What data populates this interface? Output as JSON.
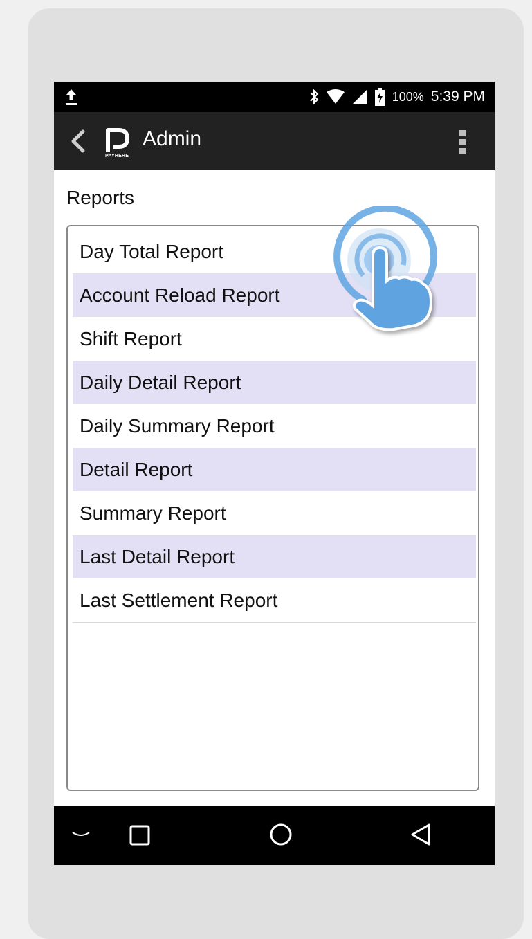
{
  "status_bar": {
    "icons": [
      "upload-icon",
      "bluetooth-icon",
      "wifi-icon",
      "cell-signal-icon",
      "battery-charging-icon"
    ],
    "battery": "100%",
    "time": "5:39 PM"
  },
  "app_bar": {
    "logo_text": "PAYHERE",
    "title": "Admin",
    "icons": [
      "back-chevron-icon",
      "payhere-logo",
      "overflow-menu-icon"
    ]
  },
  "reports": {
    "title": "Reports",
    "items": [
      {
        "label": "Day Total Report"
      },
      {
        "label": "Account Reload Report"
      },
      {
        "label": "Shift Report"
      },
      {
        "label": "Daily Detail Report"
      },
      {
        "label": "Daily Summary Report"
      },
      {
        "label": "Detail Report"
      },
      {
        "label": "Summary Report"
      },
      {
        "label": "Last Detail Report"
      },
      {
        "label": "Last Settlement Report"
      }
    ]
  },
  "nav_bar": {
    "icons": [
      "hide-keyboard-icon",
      "recent-apps-icon",
      "home-icon",
      "back-icon"
    ]
  },
  "colors": {
    "status_bar": "#000000",
    "app_bar": "#222222",
    "row_highlight": "#e3e0f5",
    "tap_hint": "#5ea4e0"
  }
}
